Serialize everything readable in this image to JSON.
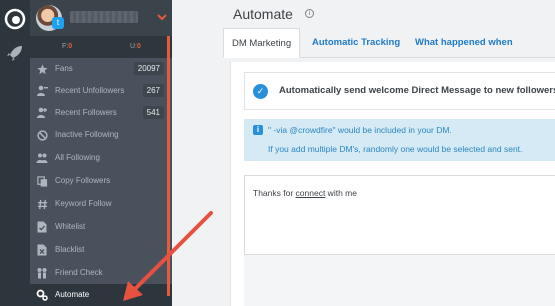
{
  "sidebar": {
    "stats": {
      "f_label": "F:",
      "f_value": "0",
      "u_label": "U:",
      "u_value": "0"
    },
    "items": [
      {
        "label": "Fans",
        "count": "20097",
        "icon": "star-icon"
      },
      {
        "label": "Recent Unfollowers",
        "count": "267",
        "icon": "recent-unfollowers-icon"
      },
      {
        "label": "Recent Followers",
        "count": "541",
        "icon": "recent-followers-icon"
      },
      {
        "label": "Inactive Following",
        "count": "",
        "icon": "ban-icon"
      },
      {
        "label": "All Following",
        "count": "",
        "icon": "users-icon"
      },
      {
        "label": "Copy Followers",
        "count": "",
        "icon": "copy-icon"
      },
      {
        "label": "Keyword Follow",
        "count": "",
        "icon": "hashtag-icon"
      },
      {
        "label": "Whitelist",
        "count": "",
        "icon": "document-check-icon"
      },
      {
        "label": "Blacklist",
        "count": "",
        "icon": "document-x-icon"
      },
      {
        "label": "Friend Check",
        "count": "",
        "icon": "friend-check-icon"
      },
      {
        "label": "Automate",
        "count": "",
        "icon": "gears-icon"
      }
    ]
  },
  "main": {
    "title": "Automate",
    "tabs": [
      {
        "label": "DM Marketing"
      },
      {
        "label": "Automatic Tracking"
      },
      {
        "label": "What happened when"
      }
    ],
    "dm_checkbox_label": "Automatically send welcome Direct Message to new followers",
    "notice_line1": "\" -via @crowdfire\" would be included in your DM.",
    "notice_line2": "If you add multiple DM's, randomly one would be selected and sent.",
    "dm_text_before": "Thanks for ",
    "dm_text_link": "connect",
    "dm_text_after": " with me"
  },
  "colors": {
    "accent": "#e85a3c",
    "link": "#1e7ac7",
    "sidebar_bg": "#49525c",
    "notice_bg": "#d6eaf5"
  }
}
